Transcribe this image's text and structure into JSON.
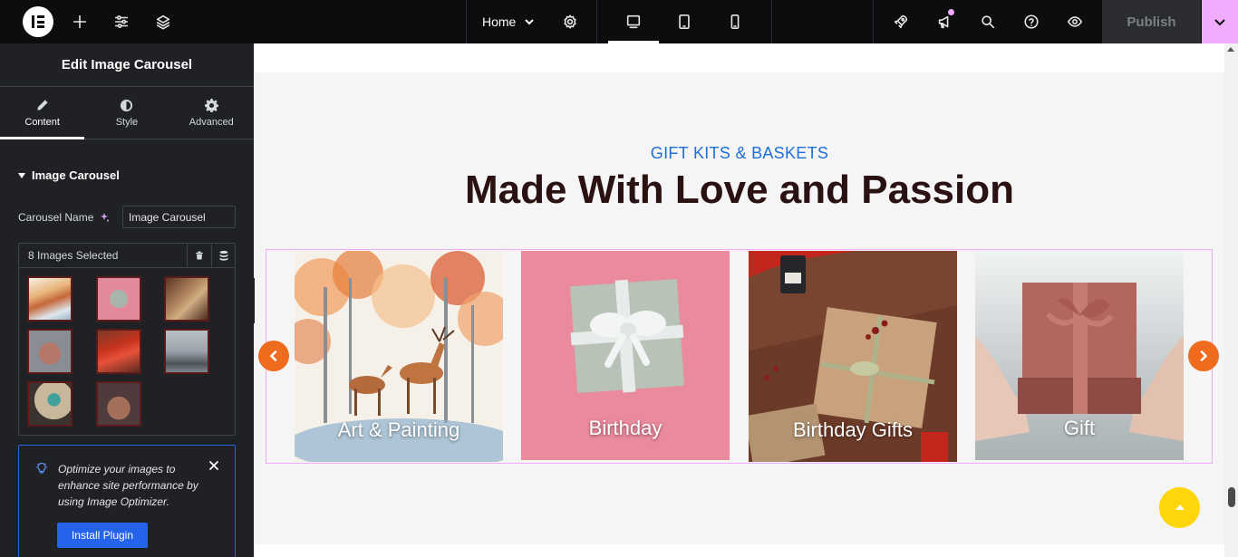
{
  "topbar": {
    "page_name": "Home",
    "publish_label": "Publish",
    "icons": [
      "elementor-logo-icon",
      "add-icon",
      "settings-sliders-icon",
      "layers-icon",
      "chevron-down-icon",
      "gear-icon",
      "desktop-icon",
      "tablet-icon",
      "mobile-icon",
      "rocket-icon",
      "megaphone-icon",
      "search-icon",
      "help-icon",
      "eye-icon"
    ]
  },
  "panel": {
    "title": "Edit Image Carousel",
    "tabs": [
      {
        "label": "Content"
      },
      {
        "label": "Style"
      },
      {
        "label": "Advanced"
      }
    ],
    "section_title": "Image Carousel",
    "carousel_name_label": "Carousel Name",
    "carousel_name_value": "Image Carousel",
    "gallery_count": "8 Images Selected",
    "notice_text": "Optimize your images to enhance site performance by using Image Optimizer.",
    "install_label": "Install Plugin"
  },
  "canvas": {
    "eyebrow": "GIFT KITS & BASKETS",
    "headline": "Made With Love and Passion",
    "slides": [
      {
        "caption": "Art & Painting"
      },
      {
        "caption": "Birthday"
      },
      {
        "caption": "Birthday Gifts"
      },
      {
        "caption": "Gift"
      }
    ]
  },
  "colors": {
    "accent_orange": "#ef6c1e",
    "eyebrow_blue": "#1e6fd9",
    "headline": "#2b1212",
    "selection_pink": "#f0abfc",
    "install_blue": "#2563eb",
    "scroll_top_yellow": "#ffd60a"
  }
}
